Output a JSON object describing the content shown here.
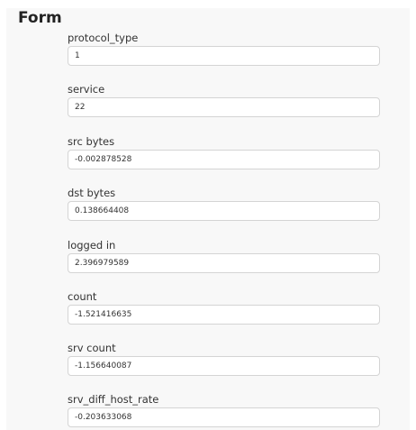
{
  "form": {
    "title": "Form",
    "fields": [
      {
        "label": "protocol_type",
        "value": "1"
      },
      {
        "label": "service",
        "value": "22"
      },
      {
        "label": "src bytes",
        "value": "-0.002878528"
      },
      {
        "label": "dst bytes",
        "value": "0.138664408"
      },
      {
        "label": "logged in",
        "value": "2.396979589"
      },
      {
        "label": "count",
        "value": "-1.521416635"
      },
      {
        "label": "srv count",
        "value": "-1.156640087"
      },
      {
        "label": "srv_diff_host_rate",
        "value": "-0.203633068"
      }
    ]
  }
}
